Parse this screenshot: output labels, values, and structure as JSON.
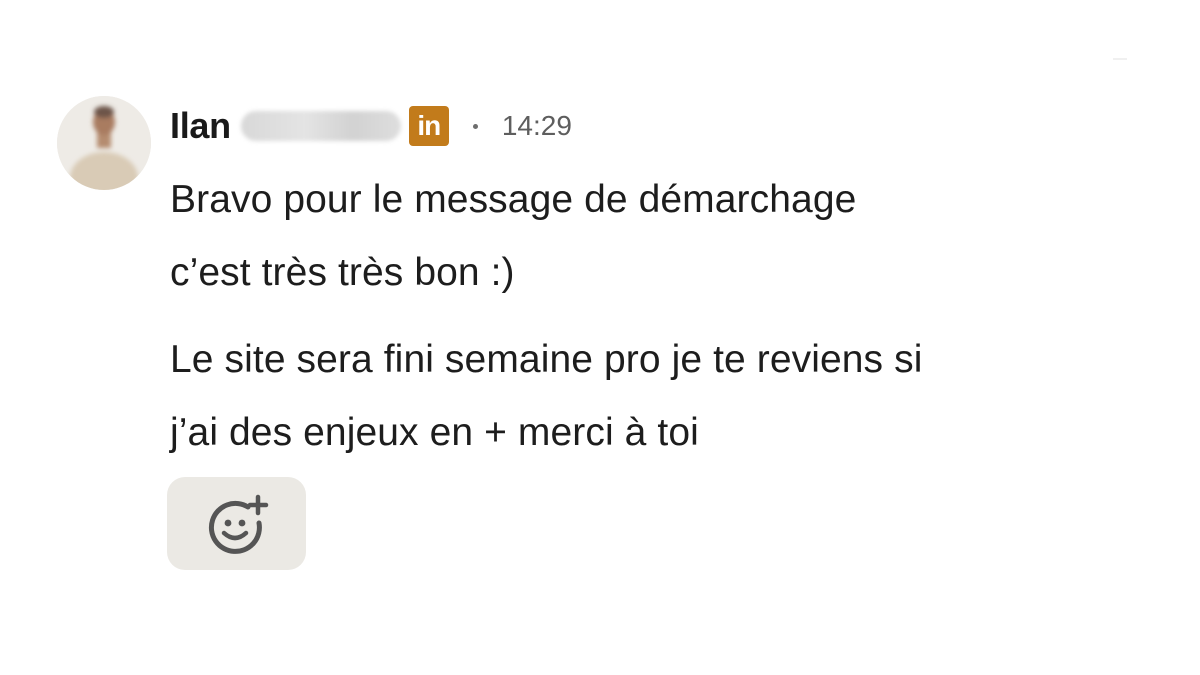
{
  "message": {
    "sender": {
      "first_name": "Ilan",
      "badge_label": "in",
      "badge_color": "#c27b1b"
    },
    "time": "14:29",
    "lines": [
      {
        "text_1": "Bravo pour le message de démarchage",
        "text_2": "c’est très très bon :)"
      },
      {
        "text_1": "Le site sera fini semaine pro je te reviens si",
        "text_2": "j’ai des enjeux en + merci à toi"
      }
    ],
    "reaction_icon": "add-reaction-icon"
  }
}
